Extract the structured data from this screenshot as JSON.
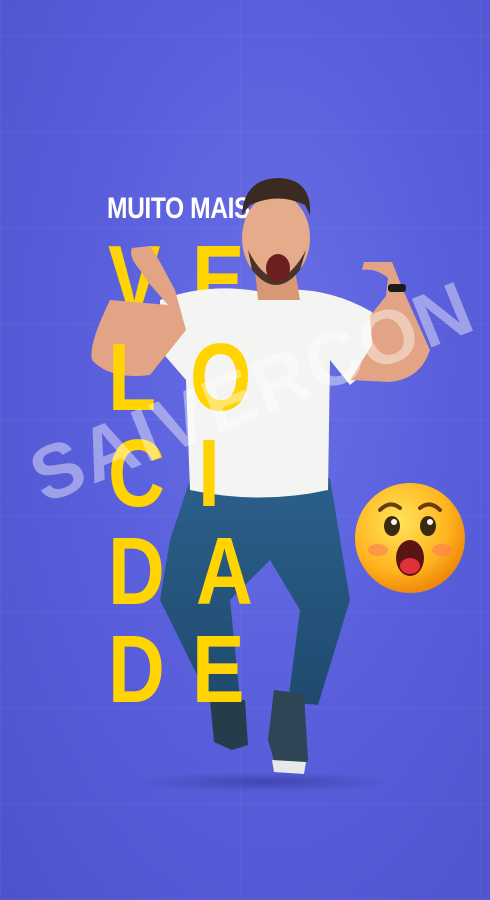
{
  "headline": {
    "small": "MUITO MAIS",
    "big_rows": [
      {
        "left": "V",
        "right": "E"
      },
      {
        "left": "L",
        "right": "O"
      },
      {
        "left": "C",
        "right": "I"
      },
      {
        "left": "D",
        "right": "A"
      },
      {
        "left": "D",
        "right": "E"
      }
    ]
  },
  "watermark": "SAIVERCON",
  "colors": {
    "background": "#5a5fdc",
    "accent_yellow": "#ffd400",
    "headline_white": "#ffffff"
  },
  "illustrations": {
    "person": "jumping-man-photo",
    "emoji": "surprised-face-emoji"
  }
}
